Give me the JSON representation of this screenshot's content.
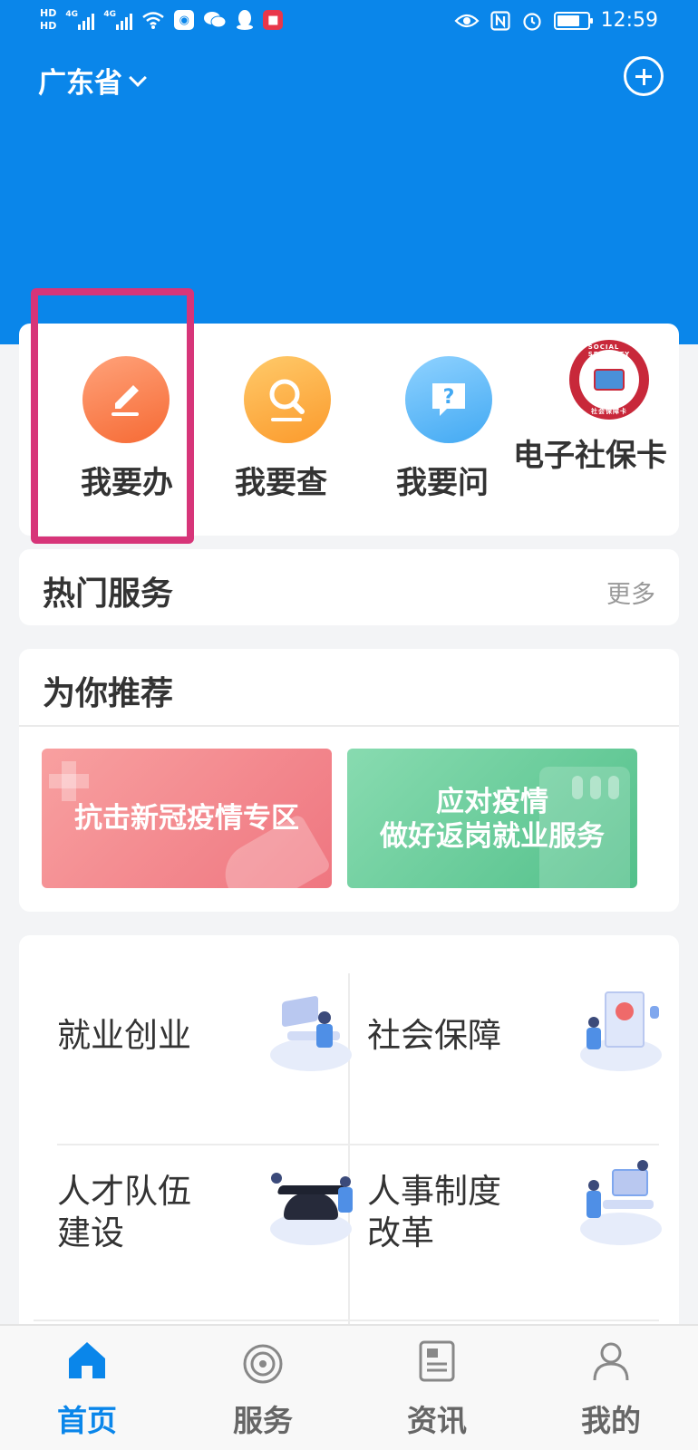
{
  "status_bar": {
    "left_labels": [
      "HD",
      "HD",
      "4G",
      "4G"
    ],
    "time": "12:59"
  },
  "header": {
    "province": "广东省",
    "add_icon": "plus-circle-icon"
  },
  "quick_actions": [
    {
      "label": "我要办",
      "icon": "pencil-icon",
      "color": "#f66a34"
    },
    {
      "label": "我要查",
      "icon": "search-icon",
      "color": "#fb9a2c"
    },
    {
      "label": "我要问",
      "icon": "question-icon",
      "color": "#42a9f3"
    },
    {
      "label": "电子社保卡",
      "icon": "social-security-card-icon",
      "color": "#c8283a",
      "seal_text_top": "SOCIAL SECURITY CARD",
      "seal_text_bottom": "社会保障卡"
    }
  ],
  "hot_services": {
    "title": "热门服务",
    "more": "更多"
  },
  "recommend": {
    "title": "为你推荐",
    "banners": [
      {
        "text": "抗击新冠疫情专区"
      },
      {
        "line1": "应对疫情",
        "line2": "做好返岗就业服务"
      }
    ]
  },
  "categories": [
    {
      "label": "就业创业"
    },
    {
      "label": "社会保障"
    },
    {
      "line1": "人才队伍",
      "line2": "建设"
    },
    {
      "line1": "人事制度",
      "line2": "改革"
    }
  ],
  "bottom_nav": [
    {
      "label": "首页",
      "icon": "home-icon",
      "active": true
    },
    {
      "label": "服务",
      "icon": "service-icon",
      "active": false
    },
    {
      "label": "资讯",
      "icon": "news-icon",
      "active": false
    },
    {
      "label": "我的",
      "icon": "user-icon",
      "active": false
    }
  ],
  "colors": {
    "brand": "#0a86ea",
    "highlight": "#d73579"
  }
}
